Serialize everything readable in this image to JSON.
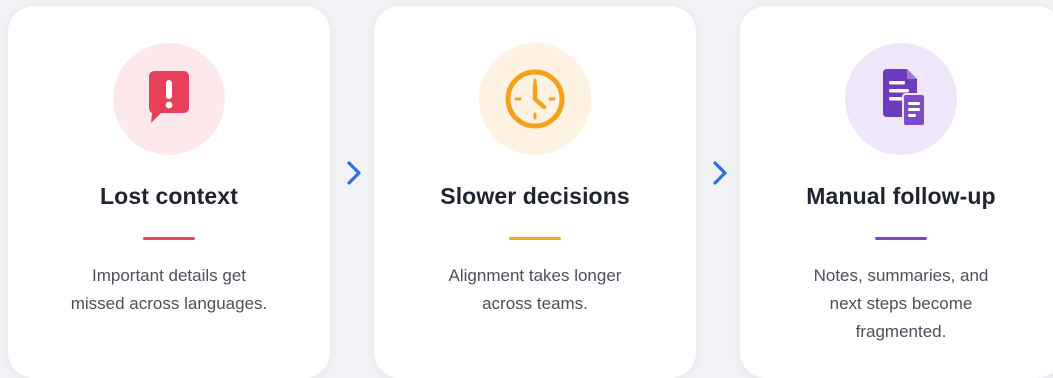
{
  "cards": [
    {
      "icon": "alert-chat-icon",
      "title": "Lost context",
      "description_lines": [
        "Important details get",
        "missed across languages."
      ],
      "accent_color": "#e8485f",
      "icon_color": "#e8405a",
      "circle_color": "#fde9ec"
    },
    {
      "icon": "clock-icon",
      "title": "Slower decisions",
      "description_lines": [
        "Alignment takes longer",
        "across teams."
      ],
      "accent_color": "#f5a623",
      "icon_color": "#f4a21c",
      "circle_color": "#fef3e2"
    },
    {
      "icon": "document-icon",
      "title": "Manual follow-up",
      "description_lines": [
        "Notes, summaries, and",
        "next steps become",
        "fragmented."
      ],
      "accent_color": "#7a47c9",
      "icon_color": "#6d3bbd",
      "circle_color": "#efe6fa"
    }
  ],
  "connectors": [
    {
      "icon": "chevron-right-icon",
      "color": "#2f6fe4"
    },
    {
      "icon": "chevron-right-icon",
      "color": "#2f6fe4"
    }
  ]
}
